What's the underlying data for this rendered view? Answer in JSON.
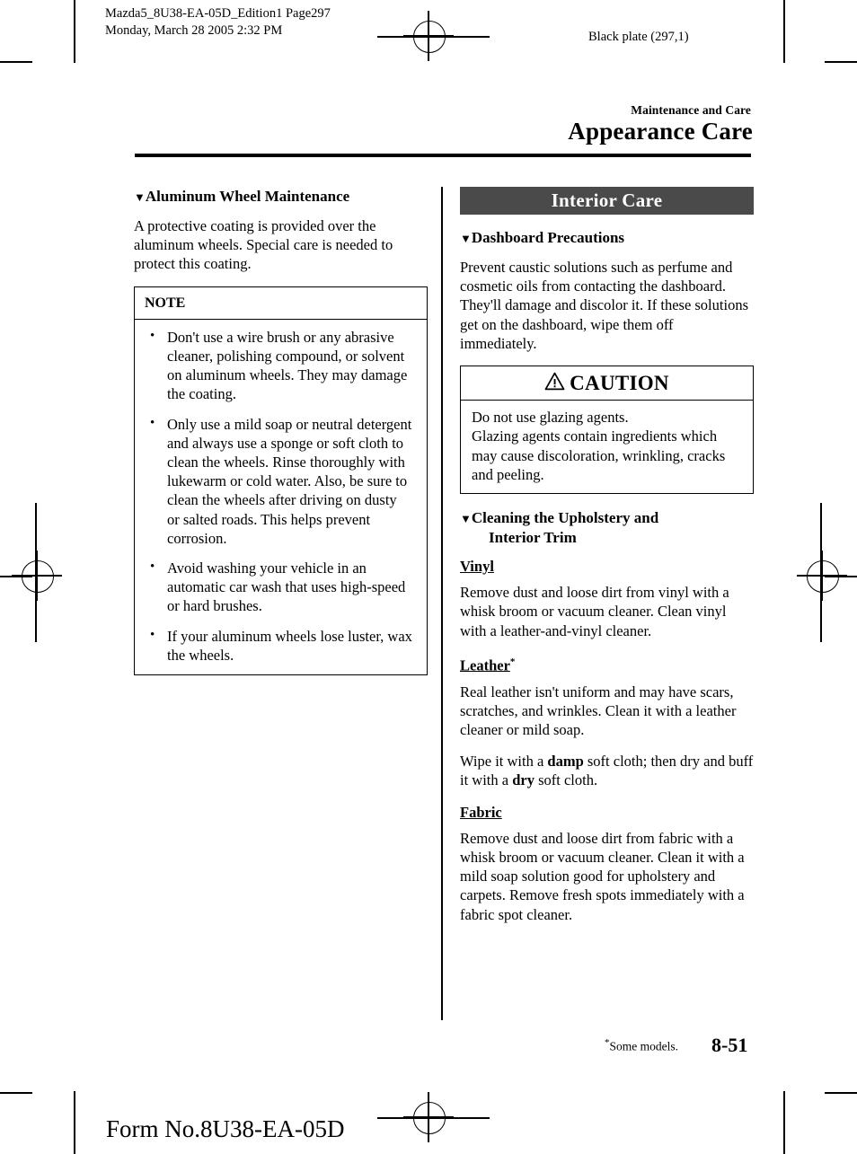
{
  "print_marks": {
    "header_line1": "Mazda5_8U38-EA-05D_Edition1 Page297",
    "header_line2": "Monday, March 28 2005 2:32 PM",
    "black_plate": "Black plate (297,1)",
    "form_number": "Form No.8U38-EA-05D"
  },
  "page_header": {
    "chapter_label": "Maintenance and Care",
    "chapter_title": "Appearance Care"
  },
  "left_column": {
    "section": {
      "marker": "▼",
      "title": "Aluminum Wheel Maintenance",
      "paragraph": "A protective coating is provided over the aluminum wheels. Special care is needed to protect this coating."
    },
    "note_box": {
      "title": "NOTE",
      "items": [
        "Don't use a wire brush or any abrasive cleaner, polishing compound, or solvent on aluminum wheels. They may damage the coating.",
        "Only use a mild soap or neutral detergent and always use a sponge or soft cloth to clean the wheels. Rinse thoroughly with lukewarm or cold water. Also, be sure to clean the wheels after driving on dusty or salted roads. This helps prevent corrosion.",
        "Avoid washing your vehicle in an automatic car wash that uses high-speed or hard brushes.",
        "If your aluminum wheels lose luster, wax the wheels."
      ]
    }
  },
  "right_column": {
    "banner": {
      "label": "Interior Care",
      "background_color": "#4a4a4a",
      "text_color": "#ffffff"
    },
    "dashboard": {
      "marker": "▼",
      "title": "Dashboard Precautions",
      "paragraph": "Prevent caustic solutions such as perfume and cosmetic oils from contacting the dashboard. They'll damage and discolor it. If these solutions get on the dashboard, wipe them off immediately."
    },
    "caution_box": {
      "icon": "warning-triangle",
      "title": "CAUTION",
      "body": "Do not use glazing agents.\nGlazing agents contain ingredients which may cause discoloration, wrinkling, cracks and peeling."
    },
    "upholstery": {
      "marker": "▼",
      "title_line1": "Cleaning the Upholstery and",
      "title_line2": "Interior Trim",
      "subsections": [
        {
          "heading": "Vinyl",
          "asterisk": "",
          "paragraphs": [
            "Remove dust and loose dirt from vinyl with a whisk broom or vacuum cleaner. Clean vinyl with a leather-and-vinyl cleaner."
          ]
        },
        {
          "heading": "Leather",
          "asterisk": "*",
          "paragraphs": [
            "Real leather isn't uniform and may have scars, scratches, and wrinkles. Clean it with a leather cleaner or mild soap."
          ],
          "rich_paragraph": {
            "part1": "Wipe it with a ",
            "bold1": "damp",
            "part2": " soft cloth; then dry and buff it with a ",
            "bold2": "dry",
            "part3": " soft cloth."
          }
        },
        {
          "heading": "Fabric",
          "asterisk": "",
          "paragraphs": [
            "Remove dust and loose dirt from fabric with a whisk broom or vacuum cleaner. Clean it with a mild soap solution good for upholstery and carpets. Remove fresh spots immediately with a fabric spot cleaner."
          ]
        }
      ]
    }
  },
  "page_footer": {
    "footnote_marker": "*",
    "footnote_text": "Some models.",
    "page_number": "8-51"
  }
}
